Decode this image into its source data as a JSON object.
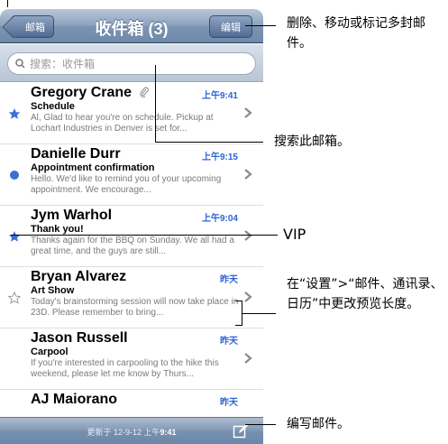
{
  "navbar": {
    "back_label": "邮箱",
    "title": "收件箱 (3)",
    "edit_label": "编辑"
  },
  "search": {
    "placeholder": "搜索：收件箱"
  },
  "messages": [
    {
      "sender": "Gregory Crane",
      "time": "上午9:41",
      "subject": "Schedule",
      "preview": "Al, Glad to hear you're on schedule. Pickup at Lochart Industries in Denver is set for...",
      "mark": "star-icon",
      "attachment": true
    },
    {
      "sender": "Danielle Durr",
      "time": "上午9:15",
      "subject": "Appointment confirmation",
      "preview": "Hello. We'd like to remind you of your upcoming appointment. We encourage...",
      "mark": "unread-dot-icon"
    },
    {
      "sender": "Jym Warhol",
      "time": "上午9:04",
      "subject": "Thank you!",
      "preview": "Thanks again for the BBQ on Sunday. We all had a great time, and the guys are still...",
      "mark": "star-icon"
    },
    {
      "sender": "Bryan Alvarez",
      "time": "昨天",
      "subject": "Art Show",
      "preview": "Today's brainstorming session will now take place in 23D. Please remember to bring...",
      "mark": "star-outline-icon"
    },
    {
      "sender": "Jason Russell",
      "time": "昨天",
      "subject": "Carpool",
      "preview": "If you're interested in carpooling to the hike this weekend, please let me know by Thurs...",
      "mark": ""
    },
    {
      "sender": "AJ Maiorano",
      "time": "昨天",
      "subject": "",
      "preview": "",
      "mark": ""
    }
  ],
  "toolbar": {
    "updated_prefix": "更新于 12-9-12 上午",
    "updated_time": "9:41"
  },
  "callouts": {
    "edit": "删除、移动或标记多封邮件。",
    "search": "搜索此邮箱。",
    "vip": "VIP",
    "preview": "在“设置”>“邮件、通讯录、日历”中更改预览长度。",
    "compose": "编写邮件。"
  },
  "colors": {
    "accent": "#2b63d6",
    "star": "#3a6fd6"
  }
}
